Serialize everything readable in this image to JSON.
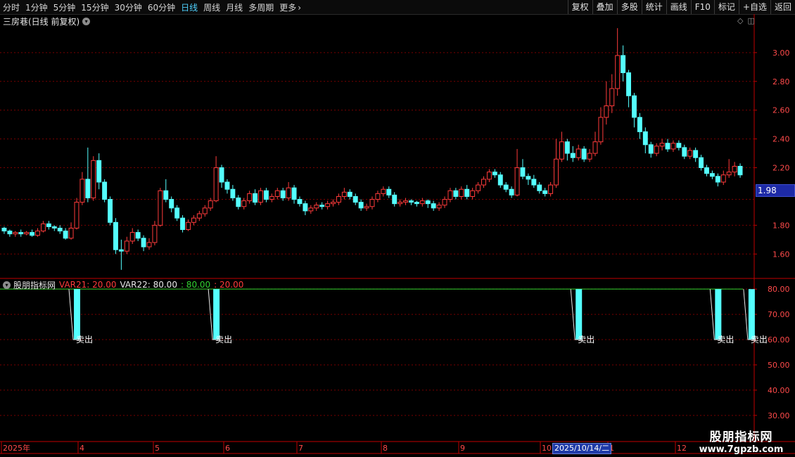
{
  "toolbar": {
    "periods": [
      "分时",
      "1分钟",
      "5分钟",
      "15分钟",
      "30分钟",
      "60分钟",
      "日线",
      "周线",
      "月线",
      "多周期",
      "更多"
    ],
    "active_period": "日线",
    "right_buttons": [
      "复权",
      "叠加",
      "多股",
      "统计",
      "画线",
      "F10",
      "标记",
      "+自选",
      "返回"
    ]
  },
  "main_title": "三房巷(日线 前复权)",
  "current_price": "1.98",
  "indicator": {
    "name": "股朋指标网",
    "var21_label": "VAR21: 20.00",
    "var22_label": "VAR22: 80.00",
    "v80": ": 80.00",
    "v20": ": 20.00",
    "signal_text": "卖出"
  },
  "price_axis": [
    "3.00",
    "2.80",
    "2.60",
    "2.40",
    "2.20",
    "1.80",
    "1.60"
  ],
  "ind_axis": [
    "80.00",
    "70.00",
    "60.00",
    "50.00",
    "40.00",
    "30.00"
  ],
  "date_axis": [
    "2025年",
    "4",
    "5",
    "6",
    "7",
    "8",
    "9",
    "10",
    "1",
    "12"
  ],
  "crosshair_date": "2025/10/14/二",
  "watermark": {
    "line1": "股朋指标网",
    "line2": "www.7gpzb.com"
  },
  "colors": {
    "up": "#ff3b3b",
    "down": "#54ffff",
    "grid": "#7a0000",
    "axis": "#c00000"
  },
  "chart_data": {
    "type": "candlestick",
    "price_range": [
      1.45,
      3.18
    ],
    "candles": [
      [
        1.78,
        1.76,
        1.79,
        1.74
      ],
      [
        1.76,
        1.74,
        1.77,
        1.72
      ],
      [
        1.74,
        1.75,
        1.76,
        1.72
      ],
      [
        1.75,
        1.74,
        1.77,
        1.72
      ],
      [
        1.74,
        1.75,
        1.76,
        1.73
      ],
      [
        1.75,
        1.73,
        1.77,
        1.72
      ],
      [
        1.73,
        1.76,
        1.78,
        1.72
      ],
      [
        1.76,
        1.81,
        1.83,
        1.75
      ],
      [
        1.81,
        1.79,
        1.83,
        1.77
      ],
      [
        1.79,
        1.78,
        1.8,
        1.76
      ],
      [
        1.78,
        1.76,
        1.8,
        1.74
      ],
      [
        1.76,
        1.71,
        1.78,
        1.7
      ],
      [
        1.71,
        1.78,
        1.82,
        1.7
      ],
      [
        1.78,
        1.96,
        1.99,
        1.77
      ],
      [
        1.96,
        2.12,
        2.17,
        1.94
      ],
      [
        2.12,
        1.99,
        2.34,
        1.96
      ],
      [
        1.99,
        2.25,
        2.28,
        1.97
      ],
      [
        2.25,
        2.1,
        2.3,
        2.05
      ],
      [
        2.1,
        1.98,
        2.12,
        1.96
      ],
      [
        1.98,
        1.82,
        2.0,
        1.8
      ],
      [
        1.82,
        1.63,
        1.85,
        1.6
      ],
      [
        1.63,
        1.62,
        1.7,
        1.49
      ],
      [
        1.62,
        1.69,
        1.72,
        1.6
      ],
      [
        1.69,
        1.75,
        1.78,
        1.67
      ],
      [
        1.75,
        1.71,
        1.77,
        1.69
      ],
      [
        1.71,
        1.65,
        1.73,
        1.62
      ],
      [
        1.65,
        1.68,
        1.71,
        1.63
      ],
      [
        1.68,
        1.8,
        1.83,
        1.66
      ],
      [
        1.8,
        2.04,
        2.06,
        1.79
      ],
      [
        2.04,
        1.98,
        2.12,
        1.96
      ],
      [
        1.98,
        1.92,
        2.0,
        1.89
      ],
      [
        1.92,
        1.85,
        1.94,
        1.83
      ],
      [
        1.85,
        1.77,
        1.87,
        1.75
      ],
      [
        1.77,
        1.82,
        1.84,
        1.76
      ],
      [
        1.82,
        1.85,
        1.87,
        1.8
      ],
      [
        1.85,
        1.88,
        1.9,
        1.83
      ],
      [
        1.88,
        1.92,
        1.94,
        1.86
      ],
      [
        1.92,
        1.97,
        1.99,
        1.9
      ],
      [
        1.97,
        2.2,
        2.28,
        1.96
      ],
      [
        2.2,
        2.1,
        2.22,
        2.06
      ],
      [
        2.1,
        2.05,
        2.12,
        2.02
      ],
      [
        2.05,
        1.99,
        2.08,
        1.97
      ],
      [
        1.99,
        1.93,
        2.01,
        1.91
      ],
      [
        1.93,
        1.97,
        1.99,
        1.91
      ],
      [
        1.97,
        2.02,
        2.04,
        1.95
      ],
      [
        2.02,
        1.96,
        2.05,
        1.94
      ],
      [
        1.96,
        2.04,
        2.06,
        1.94
      ],
      [
        2.04,
        1.98,
        2.06,
        1.96
      ],
      [
        1.98,
        2.0,
        2.02,
        1.96
      ],
      [
        2.0,
        2.04,
        2.06,
        1.98
      ],
      [
        2.04,
        1.99,
        2.06,
        1.97
      ],
      [
        1.99,
        2.06,
        2.1,
        1.97
      ],
      [
        2.06,
        1.98,
        2.08,
        1.95
      ],
      [
        1.98,
        1.95,
        2.0,
        1.93
      ],
      [
        1.95,
        1.9,
        1.97,
        1.87
      ],
      [
        1.9,
        1.92,
        1.94,
        1.88
      ],
      [
        1.92,
        1.94,
        1.96,
        1.9
      ],
      [
        1.94,
        1.93,
        1.96,
        1.91
      ],
      [
        1.93,
        1.95,
        1.97,
        1.91
      ],
      [
        1.95,
        1.96,
        1.98,
        1.93
      ],
      [
        1.96,
        2.0,
        2.02,
        1.94
      ],
      [
        2.0,
        2.03,
        2.06,
        1.98
      ],
      [
        2.03,
        2.0,
        2.05,
        1.98
      ],
      [
        2.0,
        1.96,
        2.02,
        1.94
      ],
      [
        1.96,
        1.92,
        1.98,
        1.9
      ],
      [
        1.92,
        1.93,
        1.95,
        1.9
      ],
      [
        1.93,
        1.98,
        2.0,
        1.91
      ],
      [
        1.98,
        2.02,
        2.04,
        1.96
      ],
      [
        2.02,
        2.05,
        2.07,
        2.0
      ],
      [
        2.05,
        2.01,
        2.07,
        1.99
      ],
      [
        2.01,
        1.95,
        2.03,
        1.93
      ],
      [
        1.95,
        1.96,
        1.98,
        1.93
      ],
      [
        1.96,
        1.97,
        1.99,
        1.94
      ],
      [
        1.97,
        1.96,
        1.98,
        1.94
      ],
      [
        1.96,
        1.95,
        1.97,
        1.93
      ],
      [
        1.95,
        1.97,
        1.99,
        1.93
      ],
      [
        1.97,
        1.95,
        1.98,
        1.92
      ],
      [
        1.95,
        1.92,
        1.97,
        1.9
      ],
      [
        1.92,
        1.94,
        1.96,
        1.9
      ],
      [
        1.94,
        1.98,
        2.0,
        1.92
      ],
      [
        1.98,
        2.04,
        2.06,
        1.96
      ],
      [
        2.04,
        2.0,
        2.06,
        1.98
      ],
      [
        2.0,
        2.05,
        2.07,
        1.98
      ],
      [
        2.05,
        2.0,
        2.08,
        1.98
      ],
      [
        2.0,
        2.04,
        2.06,
        1.98
      ],
      [
        2.04,
        2.08,
        2.1,
        2.02
      ],
      [
        2.08,
        2.12,
        2.14,
        2.06
      ],
      [
        2.12,
        2.17,
        2.19,
        2.1
      ],
      [
        2.17,
        2.15,
        2.19,
        2.13
      ],
      [
        2.15,
        2.08,
        2.17,
        2.06
      ],
      [
        2.08,
        2.05,
        2.1,
        2.03
      ],
      [
        2.05,
        2.01,
        2.07,
        1.99
      ],
      [
        2.01,
        2.2,
        2.33,
        2.0
      ],
      [
        2.2,
        2.14,
        2.26,
        2.12
      ],
      [
        2.14,
        2.12,
        2.16,
        2.08
      ],
      [
        2.12,
        2.08,
        2.15,
        2.06
      ],
      [
        2.08,
        2.04,
        2.1,
        2.02
      ],
      [
        2.04,
        2.02,
        2.06,
        2.0
      ],
      [
        2.02,
        2.08,
        2.1,
        2.0
      ],
      [
        2.08,
        2.26,
        2.4,
        2.06
      ],
      [
        2.26,
        2.38,
        2.45,
        2.24
      ],
      [
        2.38,
        2.3,
        2.4,
        2.25
      ],
      [
        2.3,
        2.27,
        2.35,
        2.24
      ],
      [
        2.27,
        2.33,
        2.36,
        2.25
      ],
      [
        2.33,
        2.26,
        2.35,
        2.24
      ],
      [
        2.26,
        2.3,
        2.33,
        2.24
      ],
      [
        2.3,
        2.38,
        2.45,
        2.28
      ],
      [
        2.38,
        2.55,
        2.62,
        2.36
      ],
      [
        2.55,
        2.63,
        2.8,
        2.5
      ],
      [
        2.63,
        2.75,
        2.85,
        2.58
      ],
      [
        2.75,
        2.98,
        3.17,
        2.7
      ],
      [
        2.98,
        2.86,
        3.05,
        2.8
      ],
      [
        2.86,
        2.7,
        2.88,
        2.62
      ],
      [
        2.7,
        2.55,
        2.72,
        2.48
      ],
      [
        2.55,
        2.45,
        2.58,
        2.4
      ],
      [
        2.45,
        2.36,
        2.48,
        2.3
      ],
      [
        2.36,
        2.3,
        2.38,
        2.27
      ],
      [
        2.3,
        2.35,
        2.37,
        2.28
      ],
      [
        2.35,
        2.37,
        2.4,
        2.32
      ],
      [
        2.37,
        2.33,
        2.4,
        2.31
      ],
      [
        2.33,
        2.37,
        2.39,
        2.31
      ],
      [
        2.37,
        2.34,
        2.39,
        2.32
      ],
      [
        2.34,
        2.28,
        2.36,
        2.26
      ],
      [
        2.28,
        2.32,
        2.34,
        2.26
      ],
      [
        2.32,
        2.27,
        2.34,
        2.24
      ],
      [
        2.27,
        2.2,
        2.29,
        2.18
      ],
      [
        2.2,
        2.16,
        2.22,
        2.14
      ],
      [
        2.16,
        2.14,
        2.18,
        2.12
      ],
      [
        2.14,
        2.1,
        2.16,
        2.07
      ],
      [
        2.1,
        2.15,
        2.18,
        2.08
      ],
      [
        2.15,
        2.17,
        2.26,
        2.13
      ],
      [
        2.17,
        2.21,
        2.24,
        2.14
      ],
      [
        2.21,
        2.15,
        2.23,
        2.13
      ]
    ],
    "indicator_lines": {
      "var22": 80.0,
      "var21": 20.0,
      "ind_range": [
        28.0,
        82.0
      ]
    },
    "sell_signals": [
      {
        "label": "卖出",
        "value": 60.0,
        "from": 80.0
      },
      {
        "label": "卖出",
        "value": 60.0,
        "from": 80.0
      },
      {
        "label": "卖出",
        "value": 60.0,
        "from": 80.0
      },
      {
        "label": "卖出",
        "value": 60.0,
        "from": 80.0
      },
      {
        "label": "卖出",
        "value": 60.0,
        "from": 80.0
      }
    ],
    "sell_signal_candles": [
      13,
      38,
      103,
      128,
      134
    ]
  }
}
